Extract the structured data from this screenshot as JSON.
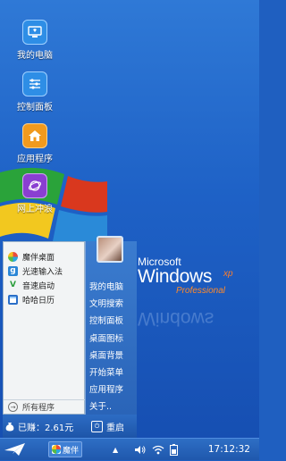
{
  "desktop": {
    "icons": [
      {
        "label": "我的电脑",
        "icon": "computer-icon",
        "color": "#2e8ee6"
      },
      {
        "label": "控制面板",
        "icon": "control-panel-icon",
        "color": "#2e8ee6"
      },
      {
        "label": "应用程序",
        "icon": "home-icon",
        "color": "#f19a1e"
      },
      {
        "label": "网上冲浪",
        "icon": "browser-icon",
        "color": "#8a3fd1"
      }
    ],
    "logo": {
      "microsoft": "Microsoft",
      "windows": "Windows",
      "xp": "xp",
      "edition": "Professional",
      "reflection": "Windows"
    }
  },
  "start_menu": {
    "left_items": [
      {
        "label": "魔伴桌面",
        "icon": "pinwheel-icon"
      },
      {
        "label": "光速输入法",
        "icon": "keyboard-g-icon"
      },
      {
        "label": "音速启动",
        "icon": "v-launch-icon"
      },
      {
        "label": "哈哈日历",
        "icon": "calendar-icon"
      }
    ],
    "all_programs": "所有程序",
    "right_items": [
      "我的电脑",
      "文明搜索",
      "控制面板",
      "桌面图标",
      "桌面背景",
      "开始菜单",
      "应用程序",
      "关于.."
    ],
    "earned": "已赚：2.61元",
    "restart": "重启"
  },
  "taskbar": {
    "task_label": "魔伴",
    "tray_arrow": "▲",
    "clock": "17:12:32"
  }
}
